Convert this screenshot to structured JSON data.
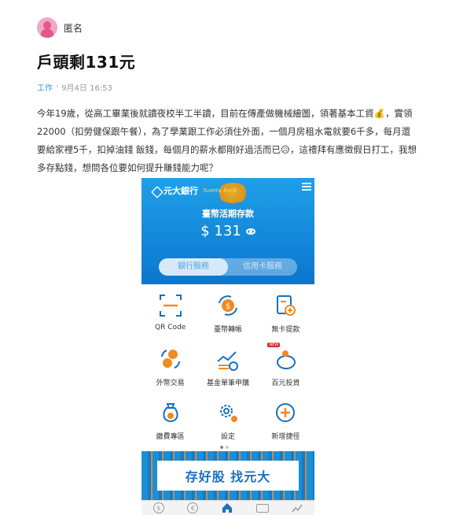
{
  "post": {
    "author": "匿名",
    "title": "戶頭剩131元",
    "category": "工作",
    "separator": "·",
    "date": "9月4日 16:53",
    "paragraph": "今年19歲，從高工畢業後就讀夜校半工半讀，目前在傳產做機械繪圖，領著基本工資💰，實領22000（扣勞健保跟午餐），為了學業跟工作必須住外面，一個月房租水電就要6千多，每月還要給家裡5千，扣掉油錢 飯錢，每個月的薪水都剛好過活而已😥，這禮拜有應徵假日打工，我想多存點錢，想問各位要如何提升賺錢能力呢？"
  },
  "bank_app": {
    "bank_name": "元大銀行",
    "bank_sub": "Yuanta Bank",
    "account_label": "臺幣活期存款",
    "balance": "$ 131",
    "tabs": [
      "銀行服務",
      "信用卡服務"
    ],
    "grid_items": [
      {
        "label": "QR Code",
        "icon": "qr-scan-icon"
      },
      {
        "label": "臺幣轉帳",
        "icon": "twd-transfer-icon"
      },
      {
        "label": "無卡提款",
        "icon": "cardless-withdraw-icon"
      },
      {
        "label": "外幣交易",
        "icon": "fx-exchange-icon"
      },
      {
        "label": "基金單筆申購",
        "icon": "fund-chart-icon"
      },
      {
        "label": "百元投資",
        "icon": "piggy-bank-icon"
      },
      {
        "label": "繳費專區",
        "icon": "payment-bag-icon"
      },
      {
        "label": "設定",
        "icon": "settings-gear-icon"
      },
      {
        "label": "新增捷徑",
        "icon": "add-shortcut-icon"
      }
    ],
    "new_badge": "NEW",
    "banner_text": "存好股 找元大",
    "bottom_nav": [
      {
        "icon": "dollar-icon",
        "glyph": "$"
      },
      {
        "icon": "euro-icon",
        "glyph": "€"
      },
      {
        "icon": "home-icon",
        "glyph": ""
      },
      {
        "icon": "card-icon",
        "glyph": ""
      },
      {
        "icon": "chart-icon",
        "glyph": ""
      }
    ],
    "colors": {
      "primary": "#0b76cf",
      "accent": "#f08a25",
      "icon_orange": "#f08a25",
      "icon_blue": "#1a6fc0"
    }
  }
}
